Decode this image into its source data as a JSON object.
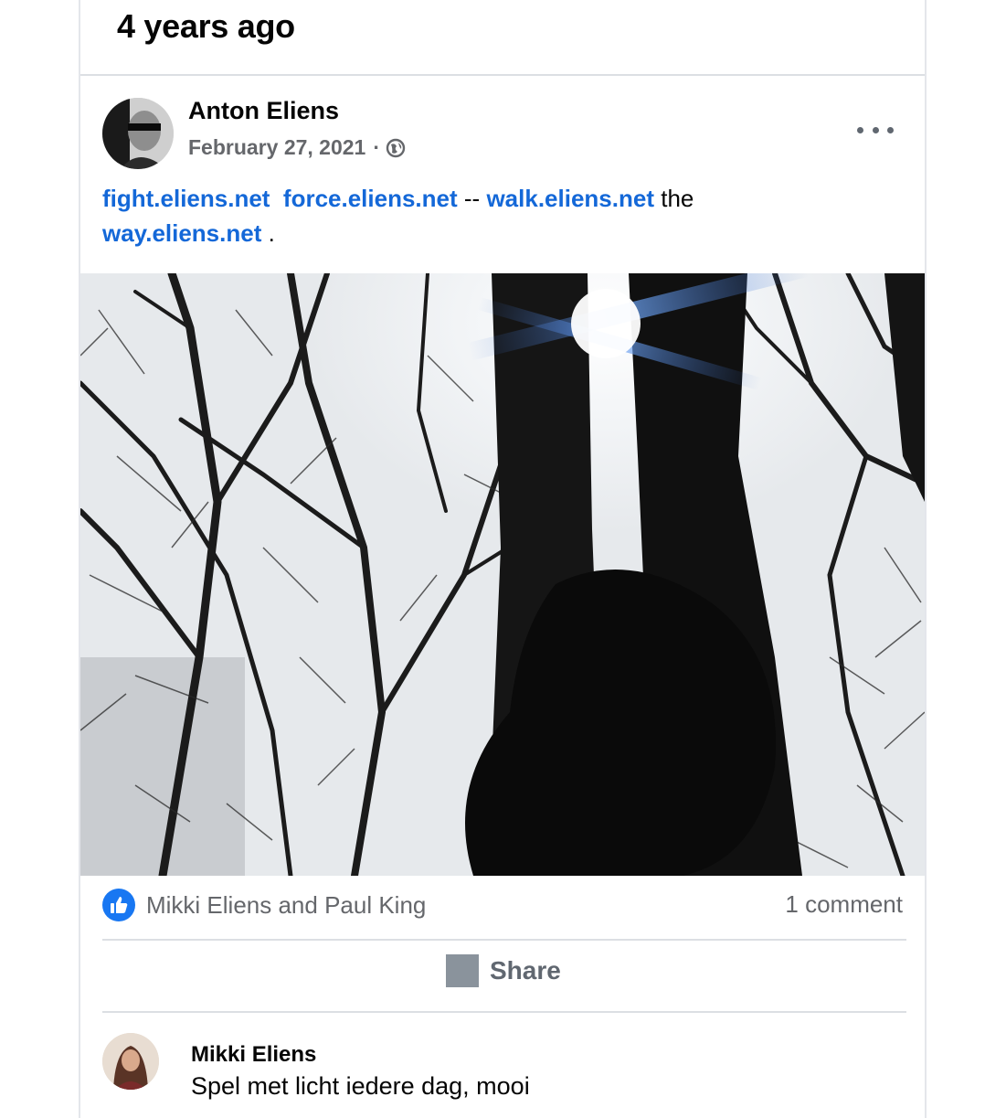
{
  "memory": {
    "title": "4 years ago"
  },
  "post": {
    "author": "Anton Eliens",
    "date": "February 27, 2021",
    "separator": "·",
    "privacy_icon": "globe-icon",
    "more_icon": "more-options-icon",
    "text": {
      "link1": "fight.eliens.net",
      "link2": "force.eliens.net",
      "sep1": "--",
      "link3": "walk.eliens.net",
      "word1": "the",
      "link4": "way.eliens.net",
      "end": "."
    },
    "photo_icon": "tree-photo"
  },
  "engagement": {
    "reactors": "Mikki Eliens and Paul King",
    "reaction_icon": "like-icon",
    "comments": "1 comment",
    "share_label": "Share"
  },
  "comment": {
    "author": "Mikki Eliens",
    "text": "Spel met licht iedere dag, mooi"
  },
  "colors": {
    "link": "#1468d8",
    "like": "#1877f2",
    "muted": "#65676b"
  }
}
